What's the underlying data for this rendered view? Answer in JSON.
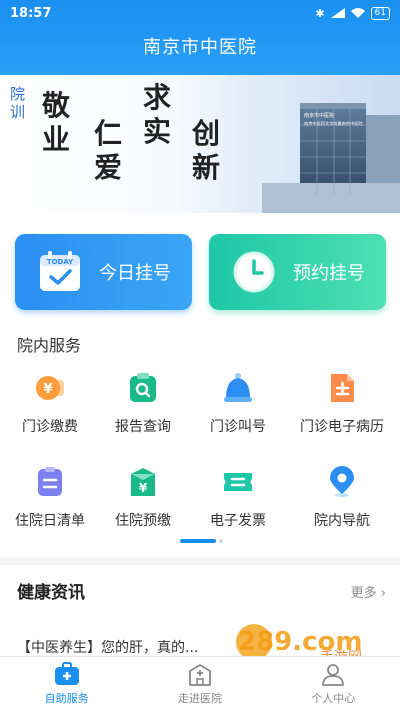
{
  "status": {
    "time": "18:57",
    "battery": "61"
  },
  "header": {
    "title": "南京市中医院"
  },
  "banner": {
    "motto_label": "院训",
    "words": [
      "敬业",
      "仁爱",
      "求实",
      "创新"
    ],
    "building_sign_1": "南京市中医院",
    "building_sign_2": "南京中医药大学附属南京中医院"
  },
  "quick_actions": [
    {
      "label": "今日挂号",
      "icon": "calendar-today-icon",
      "icon_text": "TODAY",
      "color": "#2b8ef2"
    },
    {
      "label": "预约挂号",
      "icon": "clock-icon",
      "color": "#1ec7a8"
    }
  ],
  "services": {
    "title": "院内服务",
    "items": [
      {
        "label": "门诊缴费",
        "icon": "yuan-payment-icon"
      },
      {
        "label": "报告查询",
        "icon": "report-search-icon"
      },
      {
        "label": "门诊叫号",
        "icon": "bell-icon"
      },
      {
        "label": "门诊电子病历",
        "icon": "document-icon"
      },
      {
        "label": "住院日清单",
        "icon": "clipboard-list-icon"
      },
      {
        "label": "住院预缴",
        "icon": "yuan-prepay-icon"
      },
      {
        "label": "电子发票",
        "icon": "ticket-icon"
      },
      {
        "label": "院内导航",
        "icon": "location-pin-icon"
      }
    ]
  },
  "news": {
    "title": "健康资讯",
    "more_label": "更多",
    "items": [
      {
        "text": "【中医养生】您的肝，真的..."
      }
    ]
  },
  "tabbar": [
    {
      "label": "自助服务",
      "icon": "medical-kit-icon",
      "active": true
    },
    {
      "label": "走进医院",
      "icon": "hospital-building-icon",
      "active": false
    },
    {
      "label": "个人中心",
      "icon": "person-icon",
      "active": false
    }
  ],
  "watermark": {
    "text": "289.com",
    "subtext": "手游网"
  }
}
